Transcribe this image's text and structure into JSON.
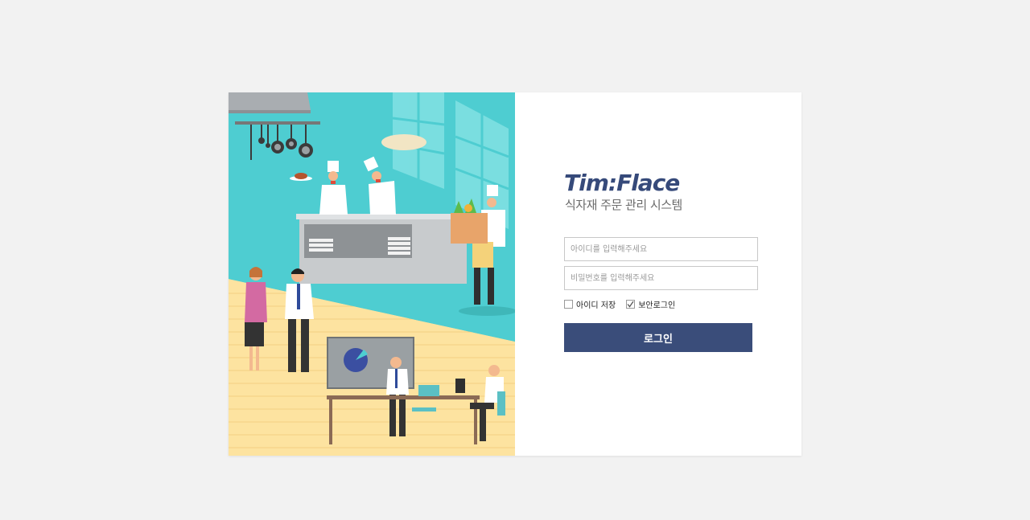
{
  "brand": {
    "logo_text": "Tim:Flace",
    "subtitle": "식자재 주문 관리 시스템"
  },
  "login": {
    "id_placeholder": "아이디를 입력해주세요",
    "pw_placeholder": "비밀번호를 입력해주세요",
    "save_id_label": "아이디 저장",
    "save_id_checked": false,
    "secure_login_label": "보안로그인",
    "secure_login_checked": true,
    "submit_label": "로그인"
  },
  "colors": {
    "page_bg": "#f2f2f2",
    "brand": "#364a7a",
    "button": "#3a4d7a",
    "illustration_teal": "#4ecdd1",
    "illustration_floor": "#fde3a0"
  },
  "illustration": {
    "description_icons": [
      "kitchen-scene",
      "chef-figure",
      "office-meeting",
      "presentation-board",
      "laptop-worker"
    ]
  }
}
